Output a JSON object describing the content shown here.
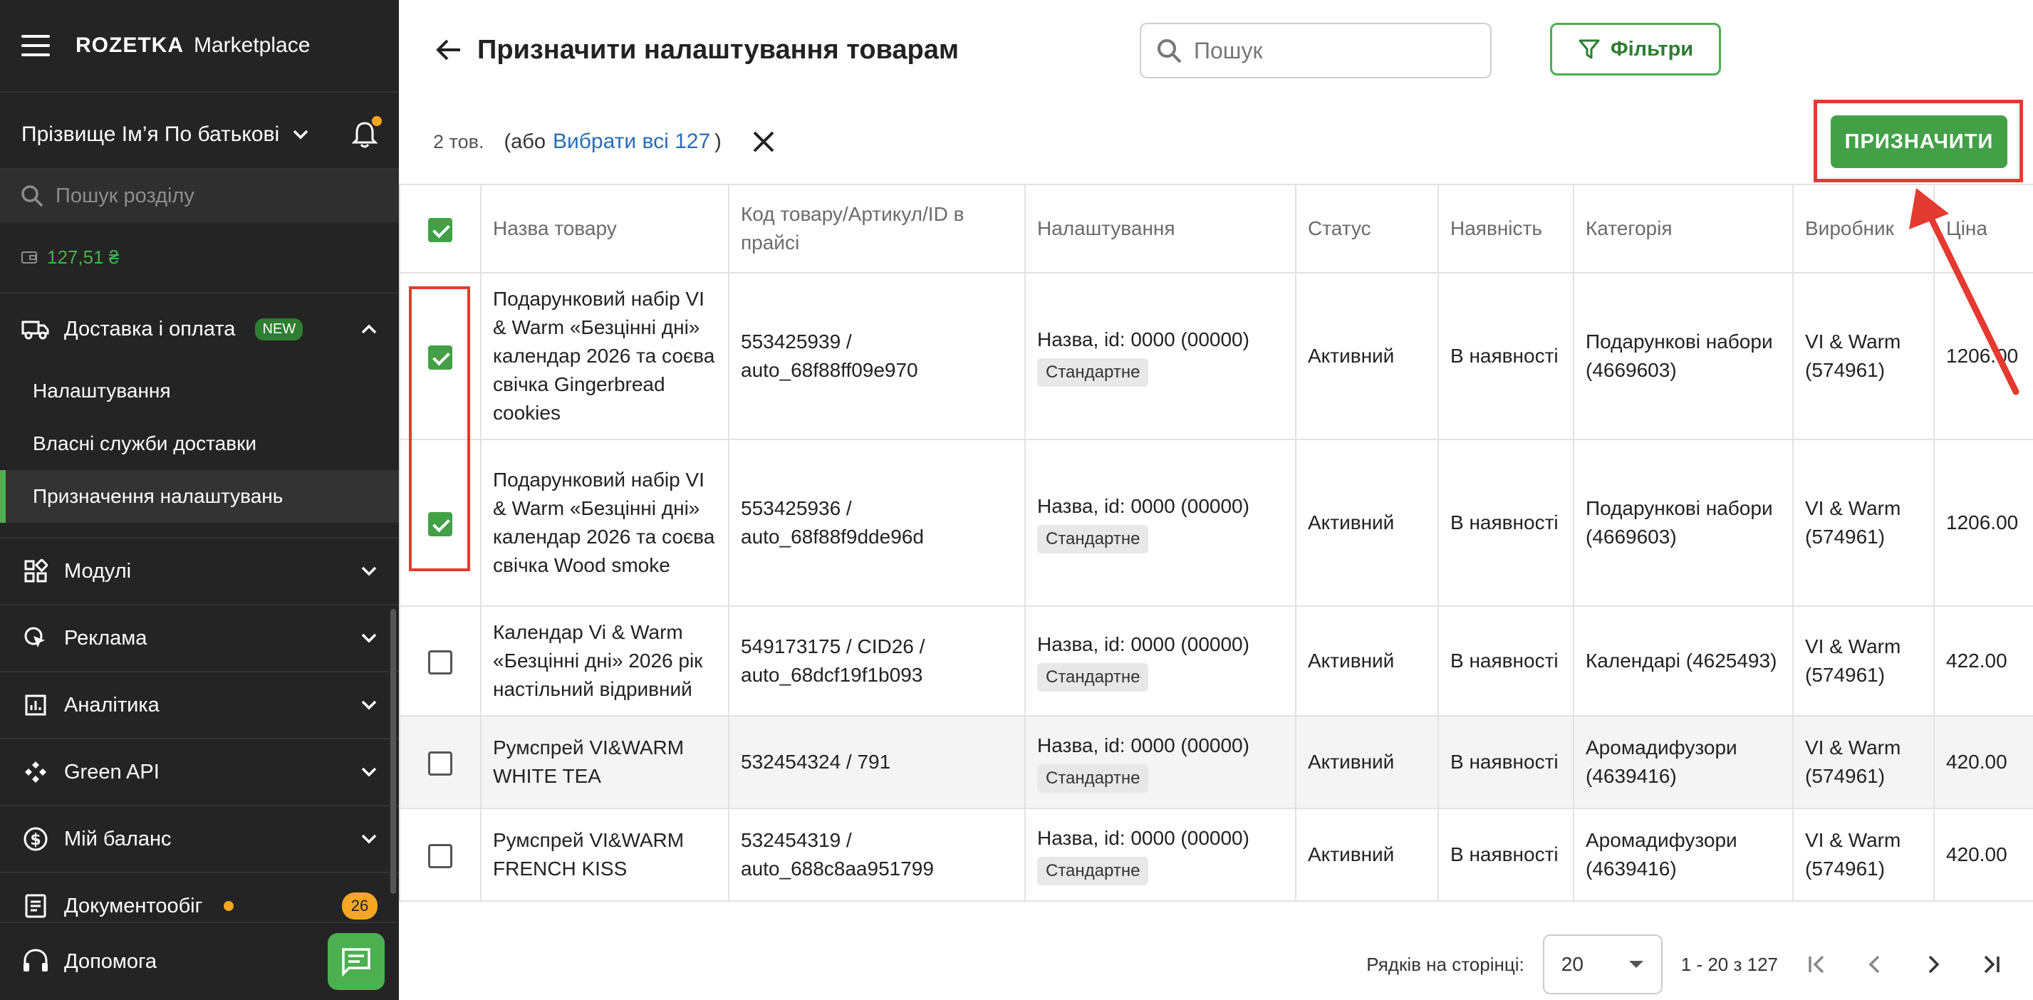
{
  "sidebar": {
    "brand": "ROZETKA",
    "brand_sub": "Marketplace",
    "user_name": "Прізвище Ім’я По батькові",
    "search_placeholder": "Пошук розділу",
    "balance": "127,51 ₴",
    "delivery": {
      "label": "Доставка і оплата",
      "badge": "NEW",
      "sub": [
        "Налаштування",
        "Власні служби доставки",
        "Призначення налаштувань"
      ]
    },
    "items": [
      {
        "label": "Модулі"
      },
      {
        "label": "Реклама"
      },
      {
        "label": "Аналітика"
      },
      {
        "label": "Green API"
      },
      {
        "label": "Мій баланс"
      },
      {
        "label": "Документообіг",
        "count": "26"
      }
    ],
    "help": "Допомога"
  },
  "header": {
    "title": "Призначити налаштування товарам",
    "search_placeholder": "Пошук",
    "filter_label": "Фільтри"
  },
  "selection": {
    "count": "2 тов.",
    "or_prefix": "(або",
    "select_all": "Вибрати всі 127",
    "or_suffix": ")",
    "assign_label": "ПРИЗНАЧИТИ"
  },
  "table": {
    "headers": [
      "Назва товару",
      "Код товару/Артикул/ID в прайсі",
      "Налаштування",
      "Статус",
      "Наявність",
      "Категорія",
      "Виробник",
      "Ціна"
    ],
    "rows": [
      {
        "checked": true,
        "name": "Подарунковий набір VI & Warm «Безцінні дні» календар 2026 та соєва свічка Gingerbread cookies",
        "code": "553425939 / auto_68f88ff09e970",
        "setting": "Назва, id: 0000 (00000)",
        "tag": "Стандартне",
        "status": "Активний",
        "stock": "В наявності",
        "category": "Подарункові набори (4669603)",
        "maker": "VI & Warm (574961)",
        "price": "1206.00"
      },
      {
        "checked": true,
        "name": "Подарунковий набір VI & Warm «Безцінні дні» календар 2026 та соєва свічка Wood smoke",
        "code": "553425936 / auto_68f88f9dde96d",
        "setting": "Назва, id: 0000 (00000)",
        "tag": "Стандартне",
        "status": "Активний",
        "stock": "В наявності",
        "category": "Подарункові набори (4669603)",
        "maker": "VI & Warm (574961)",
        "price": "1206.00"
      },
      {
        "checked": false,
        "name": "Календар Vi & Warm «Безцінні дні» 2026 рік настільний відривний",
        "code": "549173175 / CID26 / auto_68dcf19f1b093",
        "setting": "Назва, id: 0000 (00000)",
        "tag": "Стандартне",
        "status": "Активний",
        "stock": "В наявності",
        "category": "Календарі (4625493)",
        "maker": "VI & Warm (574961)",
        "price": "422.00"
      },
      {
        "checked": false,
        "name": "Румспрей VI&WARM WHITE TEA",
        "code": "532454324 / 791",
        "setting": "Назва, id: 0000 (00000)",
        "tag": "Стандартне",
        "status": "Активний",
        "stock": "В наявності",
        "category": "Аромадифузори (4639416)",
        "maker": "VI & Warm (574961)",
        "price": "420.00"
      },
      {
        "checked": false,
        "name": "Румспрей VI&WARM FRENCH KISS",
        "code": "532454319 / auto_688c8aa951799",
        "setting": "Назва, id: 0000 (00000)",
        "tag": "Стандартне",
        "status": "Активний",
        "stock": "В наявності",
        "category": "Аромадифузори (4639416)",
        "maker": "VI & Warm (574961)",
        "price": "420.00"
      }
    ]
  },
  "pager": {
    "rows_label": "Рядків на сторінці:",
    "rows_value": "20",
    "range": "1 - 20 з 127"
  },
  "colors": {
    "accent": "#43a047",
    "highlight": "#e53a2f",
    "sidebar_bg": "#242424",
    "link": "#2a6db5"
  }
}
